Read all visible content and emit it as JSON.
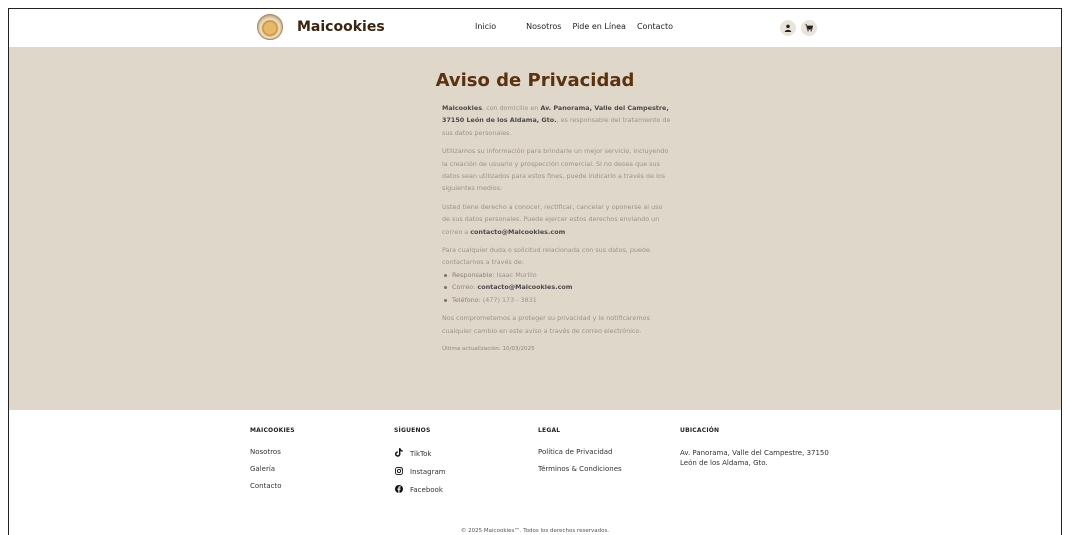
{
  "header": {
    "brand": "Maicookies",
    "nav": [
      "Inicio",
      "Nosotros",
      "Pide en Línea",
      "Contacto"
    ],
    "icons": [
      "user-icon",
      "cart-icon"
    ]
  },
  "main": {
    "title": "Aviso de Privacidad",
    "p1": {
      "brand": "Maicookies",
      "t1": ", con domicilio en ",
      "address": "Av. Panorama, Valle del Campestre, 37150 León de los Aldama, Gto.",
      "t2": ", es responsable del tratamiento de sus datos personales."
    },
    "p2": "Utilizamos su información para brindarle un mejor servicio, incluyendo la creación de usuario y prospección comercial. Si no desea que sus datos sean utilizados para estos fines, puede indicarlo a través de los siguientes medios:",
    "p3": {
      "text": "Usted tiene derecho a conocer, rectificar, cancelar y oponerse al uso de sus datos personales. Puede ejercer estos derechos enviando un correo a ",
      "email": "contacto@Maicookies.com"
    },
    "p4": "Para cualquier duda o solicitud relacionada con sus datos, puede contactarnos a través de:",
    "contact_list": {
      "resp_label": "Responsable:",
      "resp_value": " Isaac Murillo",
      "mail_label": "Correo: ",
      "mail_value": "contacto@Maicookies.com",
      "tel_label": "Teléfono:",
      "tel_value": " (477) 173 - 3831"
    },
    "p5": "Nos comprometemos a proteger su privacidad y le notificaremos cualquier cambio en este aviso a través de correo electrónico.",
    "updated": "Última actualización: 10/03/2025"
  },
  "footer": {
    "col1": {
      "heading": "MAICOOKIES",
      "links": [
        "Nosotros",
        "Galería",
        "Contacto"
      ]
    },
    "col2": {
      "heading": "SÍGUENOS",
      "links": [
        "TikTok",
        "Instagram",
        "Facebook"
      ]
    },
    "col3": {
      "heading": "LEGAL",
      "links": [
        "Política de Privacidad",
        "Términos & Condiciones"
      ]
    },
    "col4": {
      "heading": "UBICACIÓN",
      "address": "Av. Panorama, Valle del Campestre, 37150 León de los Aldama, Gto."
    },
    "copyright": "© 2025 Maicookies™. Todos los derechos reservados."
  }
}
